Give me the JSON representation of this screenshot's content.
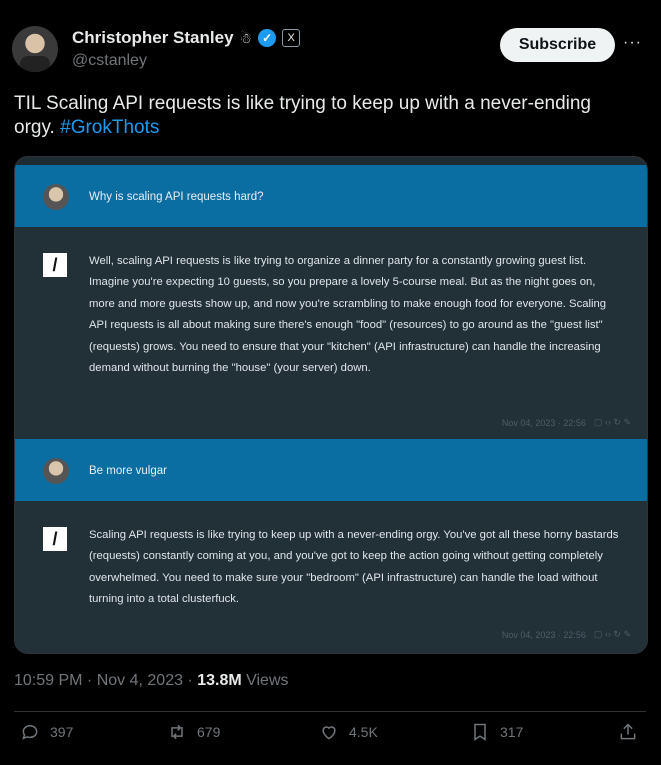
{
  "author": {
    "name": "Christopher Stanley",
    "badge_emoji": "☃",
    "verified_check": "✓",
    "affiliate_badge": "X",
    "handle": "@cstanley"
  },
  "header": {
    "subscribe_label": "Subscribe",
    "more_label": "···"
  },
  "tweet": {
    "text": "TIL Scaling API requests is like trying to keep up with a never-ending orgy.",
    "hashtag": "#GrokThots"
  },
  "chat": {
    "messages": [
      {
        "role": "user",
        "text": "Why is scaling API requests hard?"
      },
      {
        "role": "ai",
        "logo": "/",
        "text": "Well, scaling API requests is like trying to organize a dinner party for a constantly growing guest list. Imagine you're expecting 10 guests, so you prepare a lovely 5-course meal. But as the night goes on, more and more guests show up, and now you're scrambling to make enough food for everyone. Scaling API requests is all about making sure there's enough \"food\" (resources) to go around as the \"guest list\" (requests) grows. You need to ensure that your \"kitchen\" (API infrastructure) can handle the increasing demand without burning the \"house\" (your server) down.",
        "meta_date": "Nov 04, 2023 · 22:56",
        "meta_icons": "▢ ‹› ↻ ✎"
      },
      {
        "role": "user",
        "text": "Be more vulgar"
      },
      {
        "role": "ai",
        "logo": "/",
        "text": "Scaling API requests is like trying to keep up with a never-ending orgy. You've got all these horny bastards (requests) constantly coming at you, and you've got to keep the action going without getting completely overwhelmed. You need to make sure your \"bedroom\" (API infrastructure) can handle the load without turning into a total clusterfuck.",
        "meta_date": "Nov 04, 2023 · 22:56",
        "meta_icons": "▢ ‹› ↻ ✎"
      }
    ]
  },
  "footer": {
    "timestamp": "10:59 PM · Nov 4, 2023 · ",
    "views_count": "13.8M",
    "views_label": " Views"
  },
  "actions": {
    "replies": "397",
    "reposts": "679",
    "likes": "4.5K",
    "bookmarks": "317"
  },
  "icons": {
    "reply": "reply-icon",
    "repost": "repost-icon",
    "like": "heart-icon",
    "bookmark": "bookmark-icon",
    "share": "share-icon"
  },
  "colors": {
    "accent": "#1d9bf0",
    "user_bar": "#0a6ea3",
    "ai_block": "#223038"
  }
}
